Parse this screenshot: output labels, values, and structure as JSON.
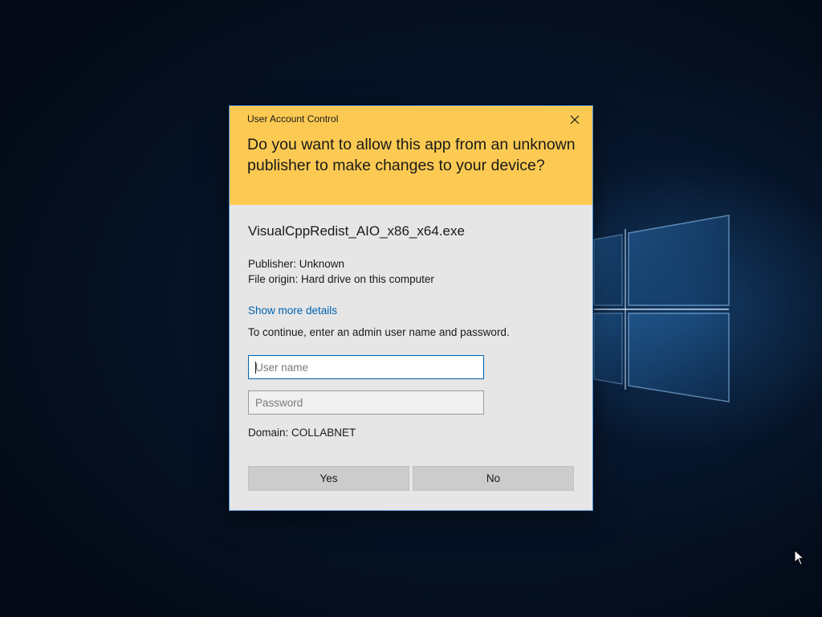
{
  "dialog": {
    "title": "User Account Control",
    "question": "Do you want to allow this app from an unknown publisher to make changes to your device?",
    "app_name": "VisualCppRedist_AIO_x86_x64.exe",
    "publisher": "Publisher: Unknown",
    "file_origin": "File origin: Hard drive on this computer",
    "details_link": "Show more details",
    "instruction": "To continue, enter an admin user name and password.",
    "username": {
      "value": "",
      "placeholder": "User name"
    },
    "password": {
      "value": "",
      "placeholder": "Password"
    },
    "domain": "Domain: COLLABNET",
    "yes_label": "Yes",
    "no_label": "No"
  },
  "icons": {
    "close": "close-icon",
    "cursor": "mouse-pointer-icon",
    "logo": "windows-logo"
  },
  "colors": {
    "header": "#fcca52",
    "body": "#e6e6e6",
    "link": "#0063b1",
    "button": "#cccccc",
    "desktop": "#050c18"
  }
}
